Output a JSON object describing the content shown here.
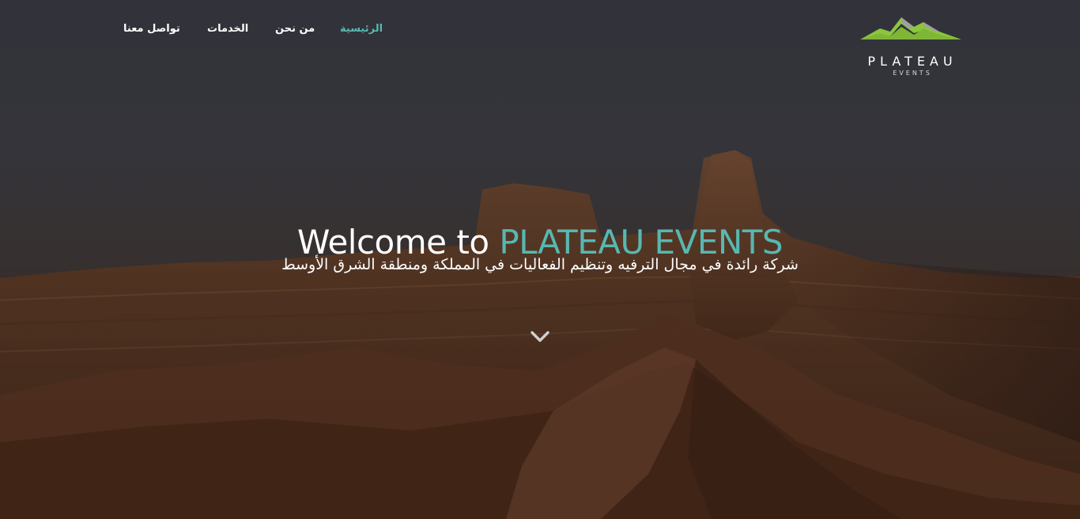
{
  "nav": {
    "items": [
      {
        "id": "home",
        "label": "الرئيسية",
        "active": true
      },
      {
        "id": "about",
        "label": "من نحن",
        "active": false
      },
      {
        "id": "services",
        "label": "الخدمات",
        "active": false
      },
      {
        "id": "contact",
        "label": "تواصل معنا",
        "active": false
      }
    ]
  },
  "logo": {
    "name": "PLATEAU",
    "sub": "EVENTS",
    "icon": "mountain-icon",
    "colors": {
      "mountain_green": "#8cc63f",
      "mountain_gray": "#9a9a9a"
    }
  },
  "hero": {
    "headline_prefix": "Welcome to ",
    "headline_brand": "PLATEAU EVENTS",
    "subtitle": "شركة رائدة في مجال الترفيه وتنظيم الفعاليات في المملكة ومنطقة الشرق الأوسط",
    "scroll_icon": "chevron-down-icon",
    "background_icon": "desert-landscape-image"
  },
  "colors": {
    "accent": "#57b8b1",
    "text": "#ffffff",
    "sky": "#393b42",
    "rock": "#6b3f24"
  }
}
